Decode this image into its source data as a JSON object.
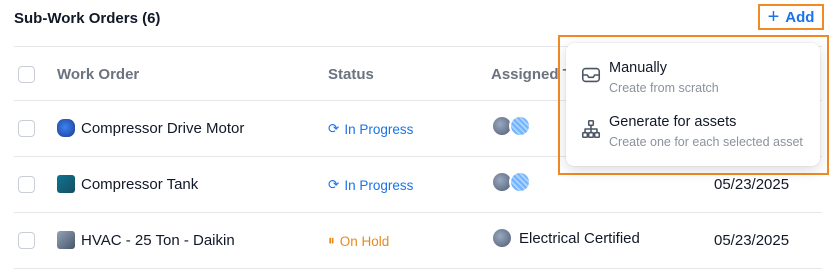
{
  "header": {
    "title": "Sub-Work Orders (6)",
    "add_label": "Add",
    "add_icon": "plus-icon"
  },
  "table": {
    "columns": [
      "Work Order",
      "Status",
      "Assigned T",
      ""
    ],
    "rows": [
      {
        "name": "Compressor Drive Motor",
        "status": "In Progress",
        "status_color": "#1a73e8",
        "assigned": "",
        "date": ""
      },
      {
        "name": "Compressor Tank",
        "status": "In Progress",
        "status_color": "#1a73e8",
        "assigned": "",
        "date": "05/23/2025"
      },
      {
        "name": "HVAC - 25 Ton - Daikin",
        "status": "On Hold",
        "status_color": "#e8891d",
        "assigned": "Electrical Certified",
        "date": "05/23/2025"
      }
    ]
  },
  "dropdown": {
    "items": [
      {
        "title": "Manually",
        "subtitle": "Create from scratch",
        "icon": "inbox-icon"
      },
      {
        "title": "Generate for assets",
        "subtitle": "Create one for each selected asset",
        "icon": "hierarchy-icon"
      }
    ]
  },
  "colors": {
    "accent": "#1a73e8",
    "highlight": "#f08a24",
    "on_hold": "#e8891d"
  }
}
